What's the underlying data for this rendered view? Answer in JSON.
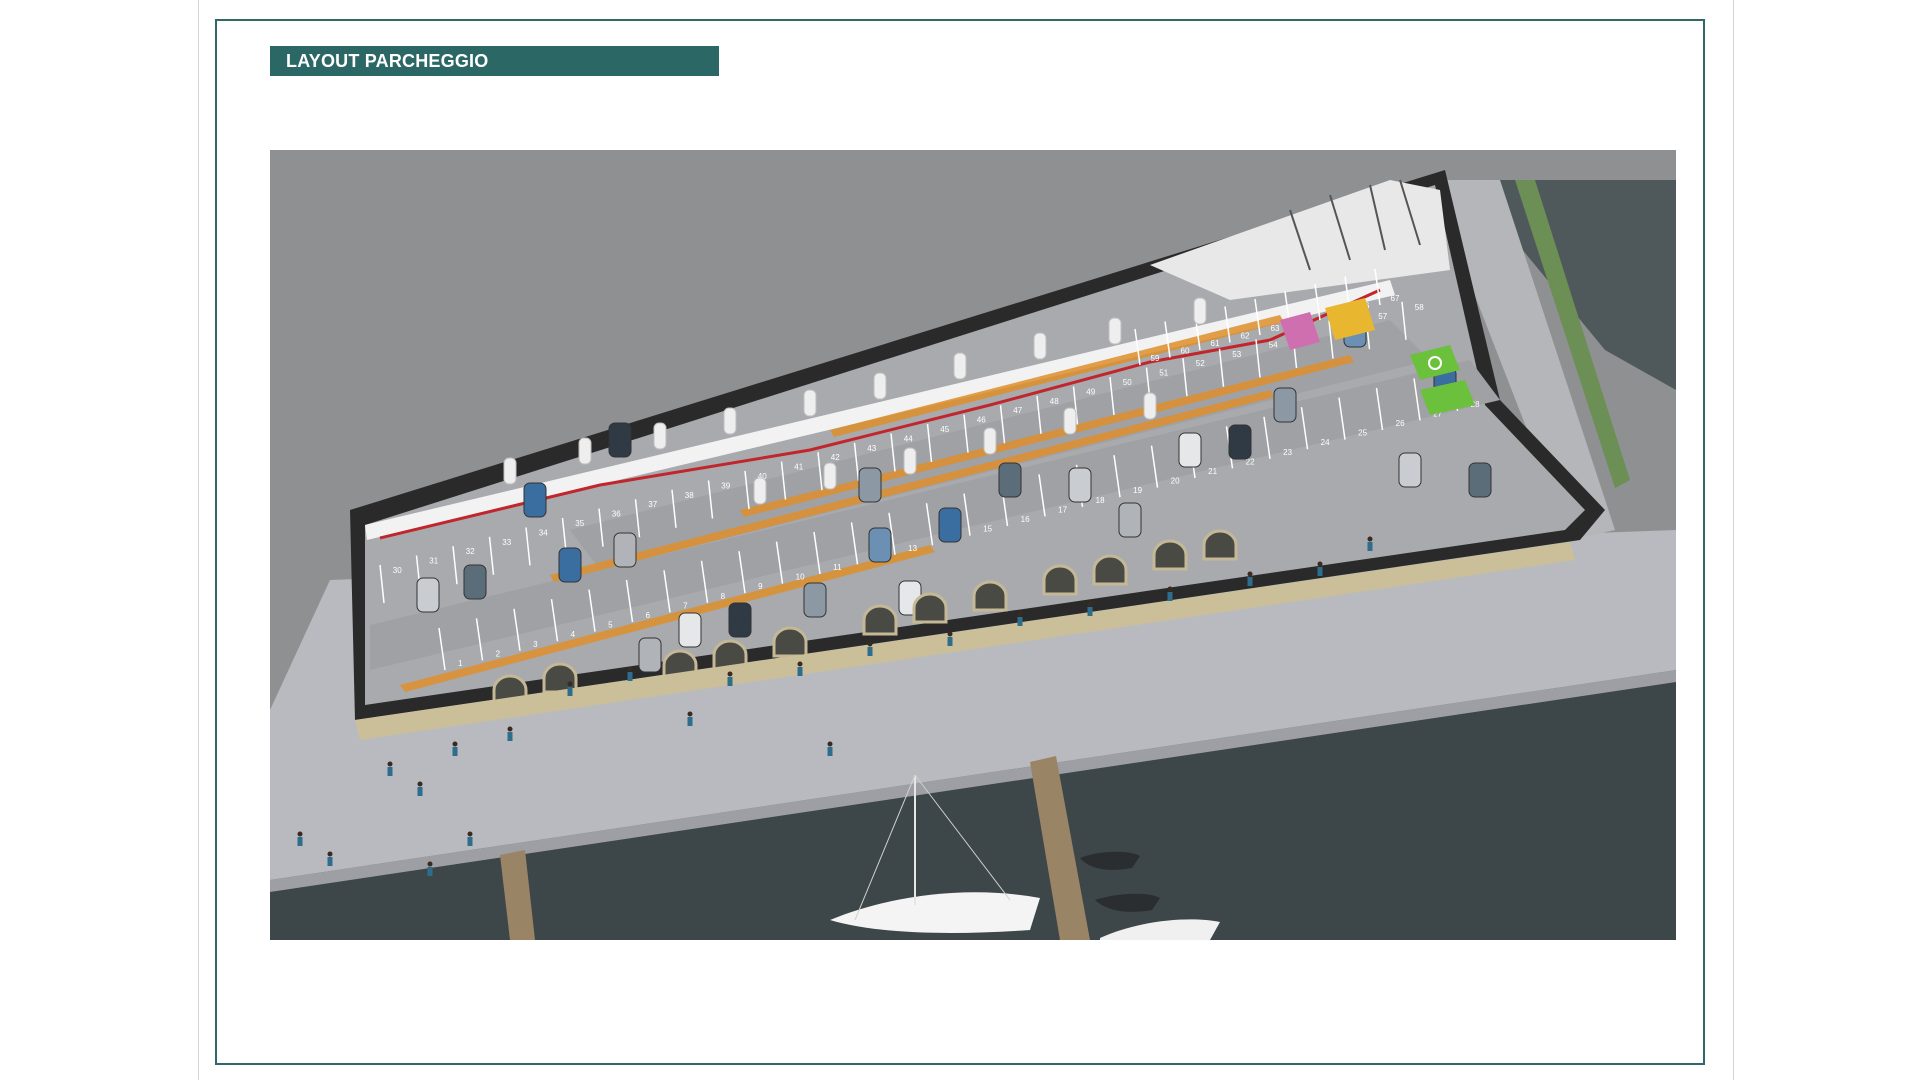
{
  "title": "LAYOUT PARCHEGGIO",
  "colors": {
    "accent": "#2b6765",
    "frame": "#2e6a66",
    "sky_gray": "#8e8f91",
    "water": "#3c4547",
    "quay": "#b9bbc0",
    "parking_floor": "#a7a9ad",
    "stripe_orange": "#e0902a",
    "ev_green": "#6bc13b"
  },
  "illustration": {
    "subject": "aerial-3d-parking-layout",
    "icons": [
      "car-icon",
      "pillar-icon",
      "boat-icon",
      "person-icon",
      "ev-charging-icon",
      "accessible-parking-icon"
    ]
  },
  "stall_numbers": {
    "front_row": [
      "1",
      "2",
      "3",
      "4",
      "5",
      "6",
      "7",
      "8",
      "9",
      "10",
      "11",
      "12",
      "13",
      "14",
      "15",
      "16",
      "17",
      "18",
      "19",
      "20",
      "21",
      "22",
      "23",
      "24",
      "25",
      "26",
      "27",
      "28"
    ],
    "middle_row": [
      "30",
      "31",
      "32",
      "33",
      "34",
      "35",
      "36",
      "37",
      "38",
      "39",
      "40",
      "41",
      "42",
      "43",
      "44",
      "45",
      "46",
      "47",
      "48",
      "49",
      "50",
      "51",
      "52",
      "53",
      "54",
      "55",
      "56",
      "57",
      "58"
    ],
    "back_row": [
      "59",
      "60",
      "61",
      "62",
      "63",
      "64",
      "65",
      "66",
      "67"
    ]
  }
}
